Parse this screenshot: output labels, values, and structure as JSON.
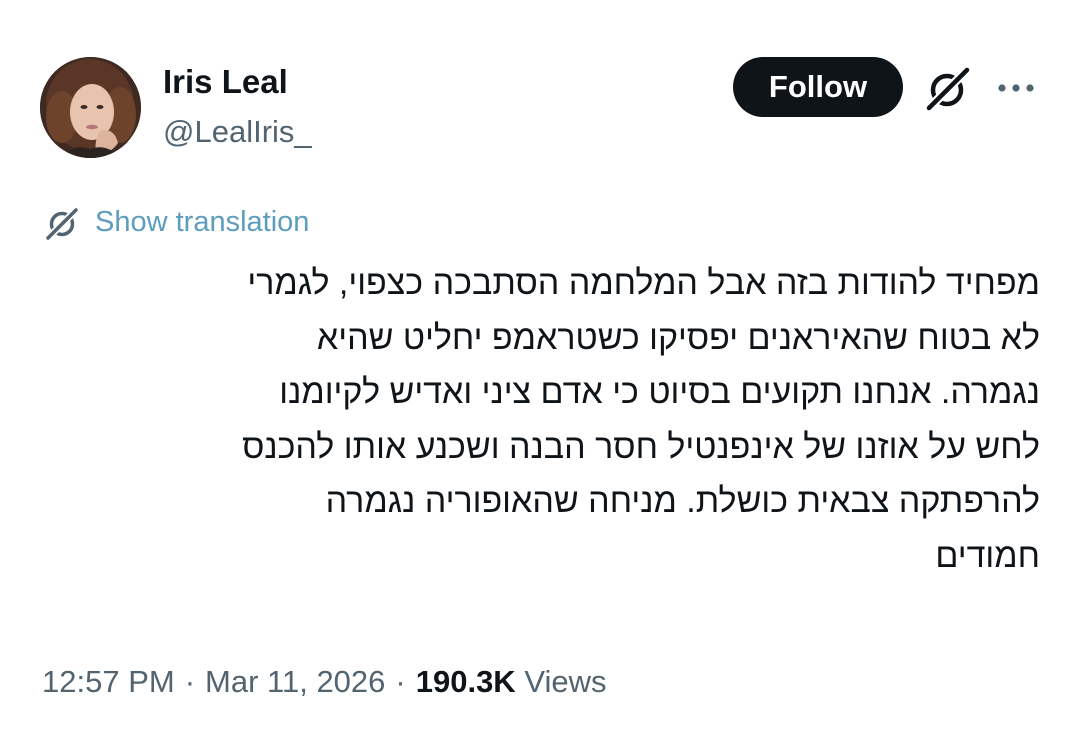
{
  "author": {
    "name": "Iris Leal",
    "handle": "@LealIris_"
  },
  "header": {
    "follow_label": "Follow",
    "grok_icon": "grok-icon",
    "more_icon": "more-dots-icon"
  },
  "translation": {
    "label": "Show translation",
    "icon": "grok-icon"
  },
  "tweet": {
    "lines": [
      "מפחיד להודות בזה אבל המלחמה הסתבכה כצפוי, לגמרי",
      "לא בטוח שהאיראנים יפסיקו כשטראמפ יחליט שהיא",
      "נגמרה. אנחנו תקועים בסיוט כי אדם ציני ואדיש לקיומנו",
      "לחש על אוזנו של אינפנטיל חסר הבנה ושכנע אותו להכנס",
      "להרפתקה צבאית כושלת. מניחה שהאופוריה נגמרה",
      "חמודים"
    ]
  },
  "meta": {
    "time": "12:57 PM",
    "separator": "·",
    "date": "Mar 11, 2026",
    "views_count": "190.3K",
    "views_label": "Views"
  },
  "colors": {
    "text": "#0f1419",
    "secondary": "#536471",
    "link": "#5d9dbd",
    "follow_bg": "#0f1419"
  }
}
